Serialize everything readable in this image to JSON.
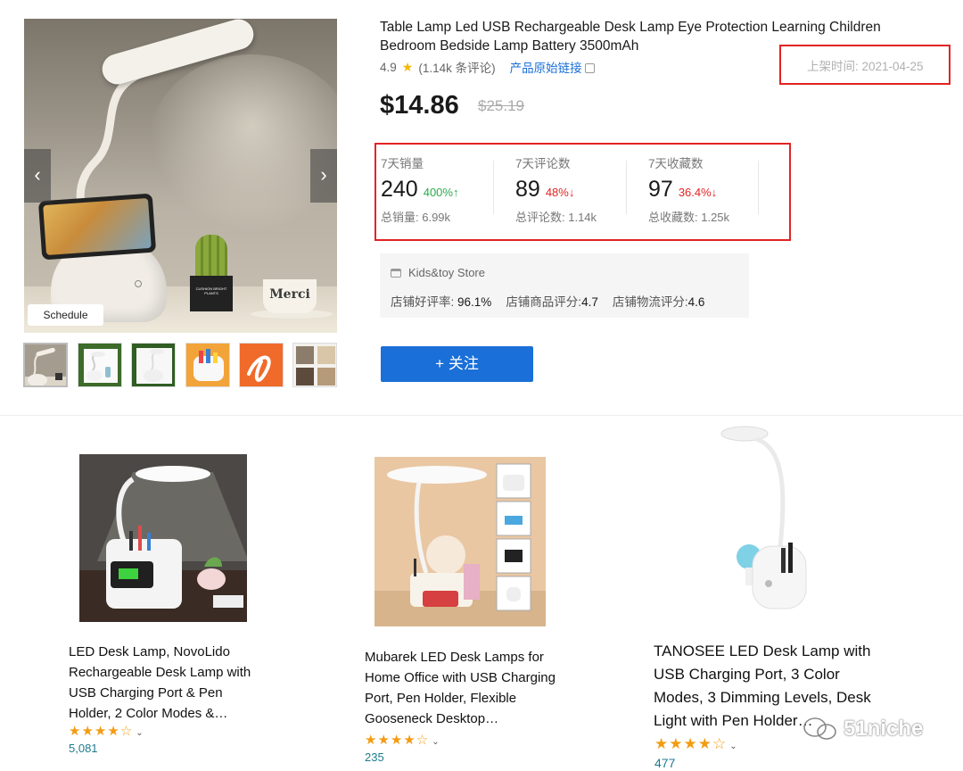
{
  "product": {
    "title": "Table Lamp Led USB Rechargeable Desk Lamp Eye Protection Learning Children Bedroom Bedside Lamp Battery 3500mAh",
    "rating": "4.9",
    "review_count": "(1.14k 条评论)",
    "original_link_label": "产品原始链接",
    "listing_date": "上架时间: 2021-04-25",
    "price": "$14.86",
    "original_price": "$25.19",
    "image_badge": "Schedule",
    "mug_text": "Merci",
    "cactus_pot_text": "CUSHION BRIGHT PLANTS",
    "follow_label": "+ 关注"
  },
  "stats": [
    {
      "label": "7天销量",
      "value": "240",
      "change": "400%↑",
      "direction": "up",
      "total": "总销量: 6.99k"
    },
    {
      "label": "7天评论数",
      "value": "89",
      "change": "48%↓",
      "direction": "down",
      "total": "总评论数: 1.14k"
    },
    {
      "label": "7天收藏数",
      "value": "97",
      "change": "36.4%↓",
      "direction": "down",
      "total": "总收藏数: 1.25k"
    }
  ],
  "store": {
    "name": "Kids&toy Store",
    "scores": [
      {
        "label": "店铺好评率:",
        "value": "96.1%"
      },
      {
        "label": "店铺商品评分:",
        "value": "4.7"
      },
      {
        "label": "店铺物流评分:",
        "value": "4.6"
      }
    ]
  },
  "listings": [
    {
      "title": "LED Desk Lamp, NovoLido Rechargeable Desk Lamp with USB Charging Port & Pen Holder, 2 Color Modes &…",
      "stars": 4,
      "reviews": "5,081"
    },
    {
      "title": "Mubarek LED Desk Lamps for Home Office with USB Charging Port, Pen Holder, Flexible Gooseneck Desktop…",
      "stars": 4,
      "reviews": "235"
    },
    {
      "title": "TANOSEE LED Desk Lamp with USB Charging Port, 3 Color Modes, 3 Dimming Levels, Desk Light with Pen Holder…",
      "stars": 4,
      "reviews": "477"
    }
  ],
  "watermark": "51niche",
  "icons": {
    "prev": "chevron-left-icon",
    "next": "chevron-right-icon",
    "star": "star-icon",
    "copy": "copy-icon",
    "store": "store-icon"
  },
  "colors": {
    "accent": "#1a6fd8",
    "highlight_border": "#e32323",
    "up": "#2aab4a",
    "down": "#e32323",
    "star": "#f5b800",
    "review_link": "#1e7b8c"
  }
}
